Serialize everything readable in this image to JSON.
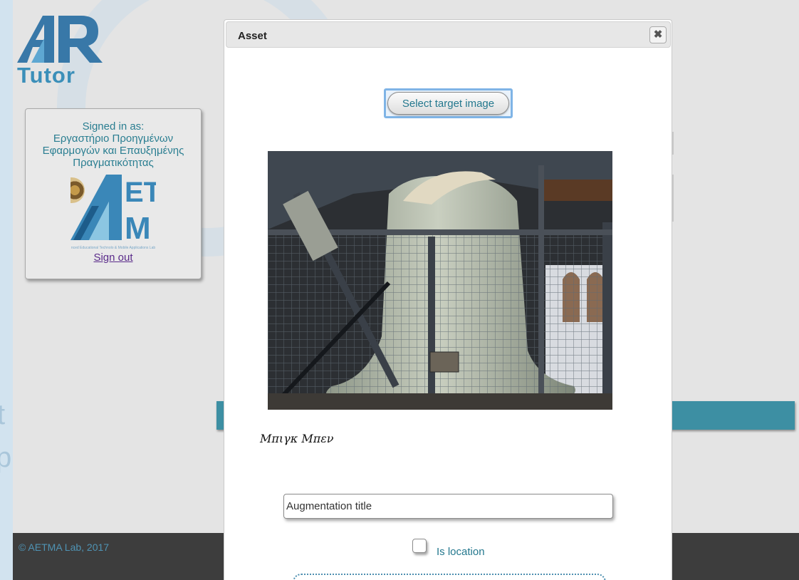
{
  "app": {
    "logo_ar": "AR",
    "logo_tutor": "Tutor"
  },
  "account": {
    "signed_in_label": "Signed in as:",
    "org_name": "Εργαστήριο Προηγμένων Εφαρμογών και Επαυξημένης Πραγματικότητας",
    "org_logo_text": "AETMA",
    "org_logo_caption": "nced Educational Technolo & Mobile Applications Lab",
    "sign_out": "Sign out"
  },
  "footer": {
    "copyright": "© AETMA Lab, 2017"
  },
  "modal": {
    "title": "Asset",
    "close_icon": "close-x-icon",
    "select_button": "Select target image",
    "image_caption": "Μπιγκ Μπεν",
    "augmentation_placeholder": "Augmentation title",
    "is_location_label": "Is location",
    "is_location_checked": false
  },
  "colors": {
    "accent_teal": "#3d8fa3",
    "link_teal": "#24788e",
    "footer_bg": "#3d3d3d",
    "logo_blue": "#3b8fb9"
  }
}
